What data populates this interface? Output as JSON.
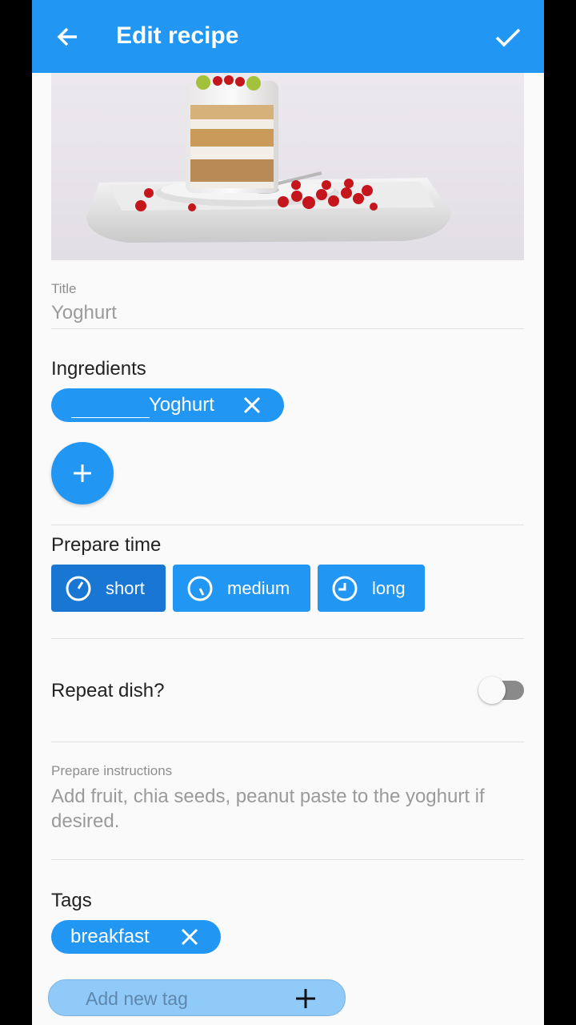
{
  "appbar": {
    "title": "Edit recipe",
    "back_icon": "arrow-left-icon",
    "confirm_icon": "check-icon",
    "color": "#2196f3"
  },
  "hero": {
    "subject": "yoghurt parfait on plate"
  },
  "title_field": {
    "label": "Title",
    "value": "Yoghurt"
  },
  "ingredients": {
    "heading": "Ingredients",
    "items": [
      {
        "label": "Yoghurt",
        "remove_icon": "close-icon"
      }
    ],
    "add_icon": "plus-icon"
  },
  "prepare_time": {
    "heading": "Prepare time",
    "options": [
      {
        "label": "short",
        "icon": "clock-icon",
        "selected": true
      },
      {
        "label": "medium",
        "icon": "clock-icon",
        "selected": false
      },
      {
        "label": "long",
        "icon": "clock-icon",
        "selected": false
      }
    ]
  },
  "repeat": {
    "label": "Repeat dish?",
    "enabled": false
  },
  "instructions": {
    "label": "Prepare instructions",
    "value": "Add fruit, chia seeds, peanut paste to the yoghurt if desired."
  },
  "tags": {
    "heading": "Tags",
    "items": [
      {
        "label": "breakfast",
        "remove_icon": "close-icon"
      }
    ],
    "add_placeholder": "Add new tag",
    "add_icon": "plus-icon"
  },
  "colors": {
    "primary": "#2196f3",
    "primary_dark": "#1976d2",
    "light": "#90caf9",
    "background": "#fafafa"
  }
}
